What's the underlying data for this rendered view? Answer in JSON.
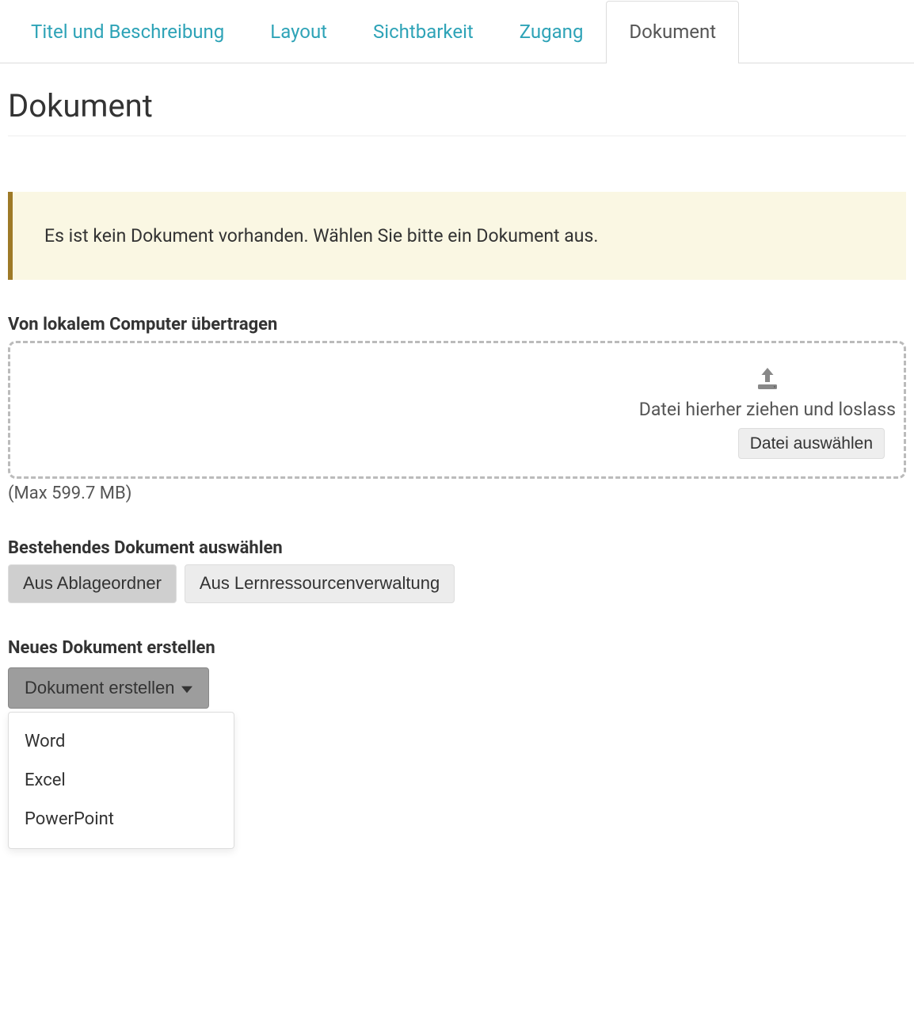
{
  "tabs": [
    {
      "label": "Titel und Beschreibung",
      "active": false
    },
    {
      "label": "Layout",
      "active": false
    },
    {
      "label": "Sichtbarkeit",
      "active": false
    },
    {
      "label": "Zugang",
      "active": false
    },
    {
      "label": "Dokument",
      "active": true
    }
  ],
  "page_title": "Dokument",
  "alert_text": "Es ist kein Dokument vorhanden. Wählen Sie bitte ein Dokument aus.",
  "upload": {
    "section_label": "Von lokalem Computer übertragen",
    "drop_text": "Datei hierher ziehen und loslass",
    "choose_button": "Datei auswählen",
    "hint": "(Max 599.7 MB)"
  },
  "existing": {
    "section_label": "Bestehendes Dokument auswählen",
    "from_folder_button": "Aus Ablageordner",
    "from_resources_button": "Aus Lernressourcenverwaltung"
  },
  "create": {
    "section_label": "Neues Dokument erstellen",
    "button_label": "Dokument erstellen",
    "menu": [
      "Word",
      "Excel",
      "PowerPoint"
    ]
  }
}
